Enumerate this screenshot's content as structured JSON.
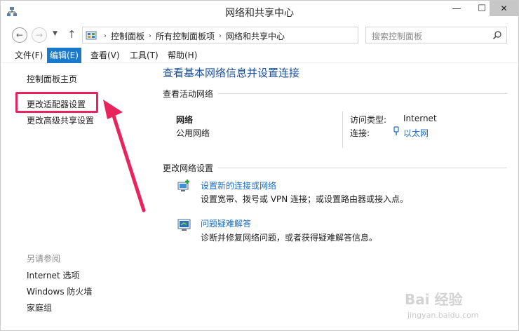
{
  "window": {
    "title": "网络和共享中心",
    "minimize_glyph": "—",
    "maximize_glyph": "☐",
    "close_glyph": "✕"
  },
  "navigation": {
    "back_glyph": "←",
    "forward_glyph": "→",
    "recent_glyph": "▼",
    "up_glyph": "↑",
    "breadcrumbs": [
      "控制面板",
      "所有控制面板项",
      "网络和共享中心"
    ],
    "crumb_separator": "›",
    "dropdown_glyph": "⌄",
    "refresh_glyph": "↻",
    "search_placeholder": "搜索控制面板"
  },
  "menu": {
    "file": "文件(F)",
    "edit": "编辑(E)",
    "view": "查看(V)",
    "tools": "工具(T)",
    "help": "帮助(H)"
  },
  "sidebar": {
    "home": "控制面板主页",
    "adapter_settings": "更改适配器设置",
    "advanced_sharing": "更改高级共享设置",
    "see_also_heading": "另请参阅",
    "see_also": [
      "Internet 选项",
      "Windows 防火墙",
      "家庭组"
    ]
  },
  "main": {
    "title": "查看基本网络信息并设置连接",
    "active_networks_heading": "查看活动网络",
    "network_name": "网络",
    "network_category": "公用网络",
    "access_type_label": "访问类型:",
    "access_type_value": "Internet",
    "connections_label": "连接:",
    "connections_value": "以太网",
    "change_settings_heading": "更改网络设置",
    "tasks": [
      {
        "link": "设置新的连接或网络",
        "desc": "设置宽带、拨号或 VPN 连接；或设置路由器或接入点。",
        "icon": "network-setup-icon"
      },
      {
        "link": "问题疑难解答",
        "desc": "诊断并修复网络问题，或者获得疑难解答信息。",
        "icon": "troubleshoot-icon"
      }
    ]
  },
  "watermark": {
    "brand": "Bai 经验",
    "url": "jingyan.baidu.com"
  },
  "colors": {
    "accent": "#1979ca",
    "link": "#1a6bc4",
    "title": "#1a4fa0",
    "annotation": "#e8245f"
  }
}
